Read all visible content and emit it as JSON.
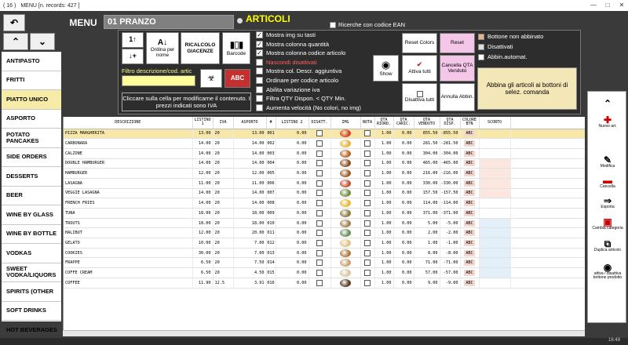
{
  "window": {
    "icon_text": "( 16 )",
    "title": "MENU  [n. records: 427 ]"
  },
  "nav": {
    "back": "↶",
    "up": "⌃",
    "down": "⌄"
  },
  "header": {
    "menu_label": "MENU",
    "menu_value": "01 PRANZO",
    "section_label": "ARTICOLI",
    "ean_label": "Ricerche con codice EAN"
  },
  "toolbar": {
    "sort_up": "1↑",
    "sort_down": "↓+",
    "order_by_name": "Ordina per nome",
    "recalc_stock": "RICALCOLO GIACENZE",
    "barcode": "Barcode",
    "filter_label": "Filtro descrizione/cod. artic",
    "filter_value": "",
    "abc_label": "ABC",
    "info_text": "Cliccare sulla cella per modificarne il contenuto. I prezzi indicati sono IVA",
    "show": "Show",
    "reset_colors": "Reset Colors",
    "reset": "Reset",
    "attiva_tutti": "Attiva tutti",
    "cancella_qta": "Cancella QTA Venduto",
    "disattiva_tutti": "Disattiva tutti",
    "annulla_abbin": "Annulla Abbin.",
    "abbina": "Abbina gli articoli ai bottoni di selez. comanda"
  },
  "options": [
    {
      "label": "Mostra img su tasti",
      "checked": true
    },
    {
      "label": "Mostra colonna quantità",
      "checked": true
    },
    {
      "label": "Mostra colonna codice articolo",
      "checked": true
    },
    {
      "label": "Nascondi disattivati",
      "checked": false
    },
    {
      "label": "Mostra col. Descr. aggiuntiva",
      "checked": false
    },
    {
      "label": "Ordinare per codice articolo",
      "checked": false
    },
    {
      "label": "Abilita variazione iva",
      "checked": false
    },
    {
      "label": "Filtra QTY Dispon. < QTY Min.",
      "checked": false
    },
    {
      "label": "Aumenta velocità (No colori, no img)",
      "checked": false
    }
  ],
  "legend": {
    "not_matched": "Bottone non abbinato",
    "disabled": "Disattivati",
    "auto_match": "Abbin.automat."
  },
  "colors": {
    "selected_row": "#f7e7a8",
    "section_yellow": "#ffff00",
    "reset_pink": "#f4c6e8",
    "abbina_bg": "#f3e7b7"
  },
  "categories": [
    "ANTIPASTO",
    "FRITTI",
    "PIATTO UNICO",
    "ASPORTO",
    "POTATO PANCAKES",
    "SIDE ORDERS",
    "DESSERTS",
    "BEER",
    "WINE BY GLASS",
    "WINE BY BOTTLE",
    "VODKAS",
    "SWEET VODKA/LIQUORS",
    "SPIRITS (OTHER",
    "SOFT DRINKS",
    "HOT BEVERAGES"
  ],
  "columns": [
    "DESCRIZIONE",
    "LISTINO 1",
    "IVA",
    "ASPORTO",
    "#",
    "LISTINO 2",
    "DISATT.",
    "IMG",
    "NOTA",
    "QTA RIORD.",
    "QTA CARIC.",
    "QTA VENDUTO",
    "QTA DISP.",
    "COLORE BTN",
    "SCONTO"
  ],
  "rows": [
    {
      "name": "PIZZA MARGHERITA",
      "l1": "13.00",
      "iva": "20",
      "asp": "13.00",
      "code": "001",
      "l2": "0.00",
      "rio": "1.00",
      "car": "0.00",
      "ven": "855.50",
      "disp": "-855.50",
      "btn": "ABC",
      "food": "#d4442b"
    },
    {
      "name": "CARBONARA",
      "l1": "14.00",
      "iva": "20",
      "asp": "14.00",
      "code": "002",
      "l2": "0.00",
      "rio": "1.00",
      "car": "0.00",
      "ven": "281.50",
      "disp": "-281.50",
      "btn": "ABC",
      "food": "#e5b43f"
    },
    {
      "name": "CALZONE",
      "l1": "14.00",
      "iva": "20",
      "asp": "14.00",
      "code": "003",
      "l2": "0.00",
      "rio": "1.00",
      "car": "0.00",
      "ven": "304.00",
      "disp": "-304.00",
      "btn": "ABC",
      "food": "#b8652a"
    },
    {
      "name": "DOUBLE HAMBURGER",
      "l1": "14.00",
      "iva": "20",
      "asp": "14.00",
      "code": "004",
      "l2": "0.00",
      "rio": "1.00",
      "car": "0.00",
      "ven": "465.00",
      "disp": "-465.00",
      "btn": "ABC",
      "food": "#8a4d1f"
    },
    {
      "name": "HAMBURGER",
      "l1": "12.00",
      "iva": "20",
      "asp": "12.00",
      "code": "005",
      "l2": "0.00",
      "rio": "1.00",
      "car": "0.00",
      "ven": "216.00",
      "disp": "-216.00",
      "btn": "ABC",
      "food": "#9c5a24"
    },
    {
      "name": "LASAGNA",
      "l1": "11.00",
      "iva": "20",
      "asp": "11.00",
      "code": "006",
      "l2": "0.00",
      "rio": "1.00",
      "car": "0.00",
      "ven": "330.00",
      "disp": "-330.00",
      "btn": "ABC",
      "food": "#c4502f"
    },
    {
      "name": "VEGGIE LASAGNA",
      "l1": "14.00",
      "iva": "20",
      "asp": "14.00",
      "code": "007",
      "l2": "0.00",
      "rio": "1.00",
      "car": "0.00",
      "ven": "157.50",
      "disp": "-157.50",
      "btn": "ABC",
      "food": "#6e8f3a"
    },
    {
      "name": "FRENCH FRIES",
      "l1": "14.00",
      "iva": "20",
      "asp": "14.00",
      "code": "008",
      "l2": "0.00",
      "rio": "1.00",
      "car": "0.00",
      "ven": "114.00",
      "disp": "-114.00",
      "btn": "ABC",
      "food": "#e8b737"
    },
    {
      "name": "TUNA",
      "l1": "18.00",
      "iva": "20",
      "asp": "18.00",
      "code": "009",
      "l2": "0.00",
      "rio": "1.00",
      "car": "0.00",
      "ven": "371.00",
      "disp": "-371.00",
      "btn": "ABC",
      "food": "#8a7a3d"
    },
    {
      "name": "TROUTS",
      "l1": "18.00",
      "iva": "20",
      "asp": "18.00",
      "code": "010",
      "l2": "0.00",
      "rio": "1.00",
      "car": "0.00",
      "ven": "5.00",
      "disp": "-5.00",
      "btn": "ABC",
      "food": "#a08050"
    },
    {
      "name": "HALIBUT",
      "l1": "12.00",
      "iva": "20",
      "asp": "20.00",
      "code": "011",
      "l2": "0.00",
      "rio": "1.00",
      "car": "0.00",
      "ven": "2.00",
      "disp": "-2.00",
      "btn": "ABC",
      "food": "#6a8c5c"
    },
    {
      "name": "GELATO",
      "l1": "10.00",
      "iva": "20",
      "asp": "7.00",
      "code": "012",
      "l2": "0.00",
      "rio": "1.00",
      "car": "0.00",
      "ven": "1.00",
      "disp": "-1.00",
      "btn": "ABC",
      "food": "#e2c080"
    },
    {
      "name": "COOKIES",
      "l1": "30.00",
      "iva": "20",
      "asp": "7.00",
      "code": "013",
      "l2": "0.00",
      "rio": "1.00",
      "car": "0.00",
      "ven": "8.00",
      "disp": "-8.00",
      "btn": "ABC",
      "food": "#b07a3a"
    },
    {
      "name": "FRAPPE",
      "l1": "6.50",
      "iva": "20",
      "asp": "7.50",
      "code": "014",
      "l2": "0.00",
      "rio": "1.00",
      "car": "0.00",
      "ven": "71.00",
      "disp": "-71.00",
      "btn": "ABC",
      "food": "#caa070"
    },
    {
      "name": "COFFE CREAM",
      "l1": "6.50",
      "iva": "20",
      "asp": "4.50",
      "code": "015",
      "l2": "0.00",
      "rio": "1.00",
      "car": "0.00",
      "ven": "57.00",
      "disp": "-57.00",
      "btn": "ABC",
      "food": "#d8c4a0"
    },
    {
      "name": "COFFEE",
      "l1": "11.90",
      "iva": "12.5",
      "asp": "3.91",
      "code": "016",
      "l2": "0.00",
      "rio": "1.00",
      "car": "0.00",
      "ven": "9.00",
      "disp": "-9.00",
      "btn": "ABC",
      "food": "#5a3a20"
    }
  ],
  "actions": {
    "nuovo": "Nuovo art.",
    "modifica": "Modifica",
    "cancella": "Cancella",
    "esporta": "Esporta",
    "cambia": "Cambia categoria",
    "duplica": "Duplica articolo",
    "attiva": "attiva / disattiva bottone prodotto"
  },
  "clock": "16:49"
}
